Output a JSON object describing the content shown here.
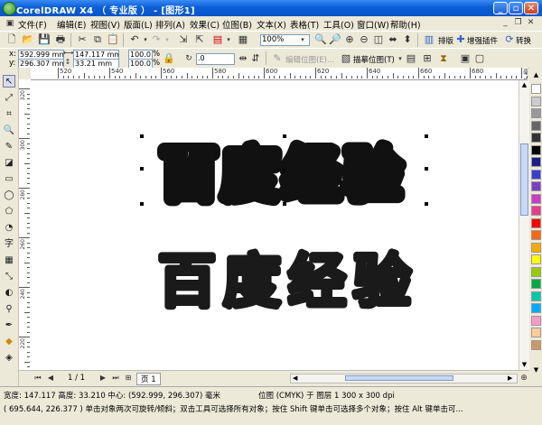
{
  "window": {
    "title": "CorelDRAW X4 （ 专业版 ） - [图形1]"
  },
  "menu": [
    "文件(F)",
    "编辑(E)",
    "视图(V)",
    "版面(L)",
    "排列(A)",
    "效果(C)",
    "位图(B)",
    "文本(X)",
    "表格(T)",
    "工具(O)",
    "窗口(W)",
    "帮助(H)"
  ],
  "toolbar1": {
    "zoom_value": "100%",
    "layout_button": "排版",
    "plugin_button": "增强插件",
    "convert_button": "转换"
  },
  "property_bar": {
    "x_label": "x:",
    "x_value": "592.999 mm",
    "y_label": "y:",
    "y_value": "296.307 mm",
    "width_value": "147.117 mm",
    "height_value": "33.21 mm",
    "scale_w": "100.0",
    "scale_h": "100.0",
    "percent_symbol": "%",
    "rotation_value": ".0",
    "edit_bitmap_label": "编辑位图(E)...",
    "trace_bitmap_label": "描摹位图(T)"
  },
  "ruler_top_labels": [
    "520",
    "540",
    "560",
    "580",
    "600",
    "620",
    "640",
    "660",
    "680",
    "毫米"
  ],
  "ruler_left_labels": [
    "320",
    "300",
    "280",
    "260",
    "240",
    "220"
  ],
  "canvas": {
    "text_outlined": "百度经验",
    "text_solid": "百度经验"
  },
  "page_nav": {
    "page_count": "1 / 1",
    "page_tab": "页 1"
  },
  "status": {
    "line1_dims": "宽度: 147.117 高度: 33.210 中心: (592.999, 296.307) 毫米",
    "line1_object": "位图 (CMYK) 于 图层 1 300 x 300 dpi",
    "line2": "( 695.644, 226.377 )   单击对象两次可旋转/倾斜；双击工具可选择所有对象；按住 Shift 键单击可选择多个对象；按住 Alt 键单击可..."
  },
  "palette_colors": [
    "#ffffff",
    "#cccccc",
    "#999999",
    "#666666",
    "#333333",
    "#000000",
    "#1c1c8c",
    "#3b3bd6",
    "#7c3cc8",
    "#c83cc8",
    "#e83c8c",
    "#ff0000",
    "#ff6600",
    "#ffaa00",
    "#ffff00",
    "#99cc00",
    "#00aa44",
    "#00ccaa",
    "#00aaff",
    "#ff99cc",
    "#ffcc99",
    "#cc9966"
  ]
}
